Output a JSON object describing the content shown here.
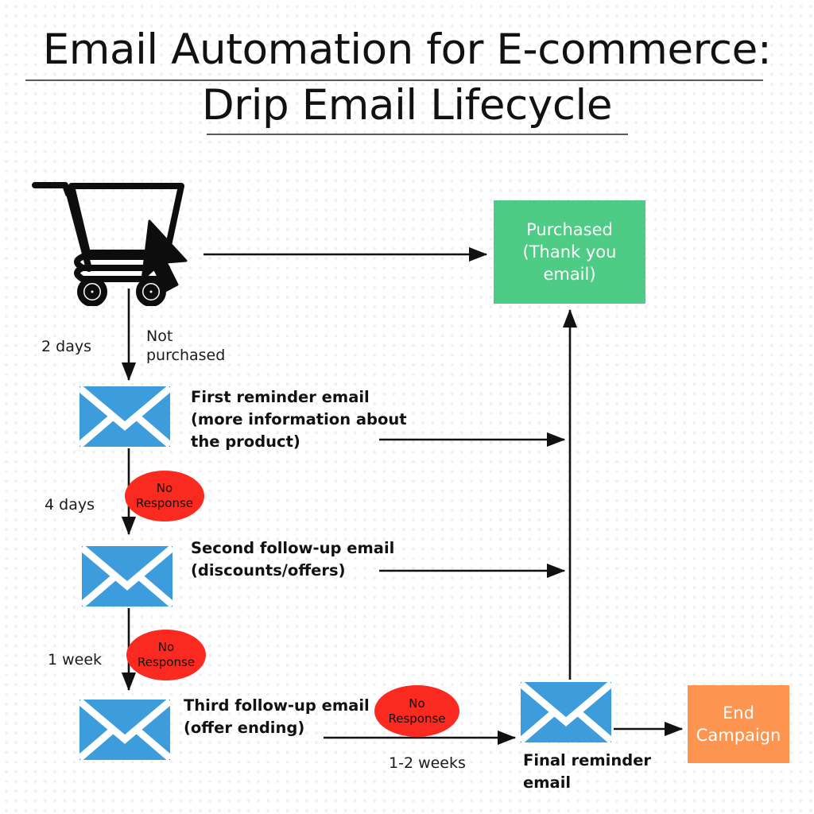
{
  "title": {
    "line1": "Email Automation for E-commerce:",
    "line2": "Drip Email Lifecycle"
  },
  "nodes": {
    "cart": {
      "icon": "shopping-cart-cursor-icon"
    },
    "purchased": {
      "label": "Purchased\n(Thank you\nemail)",
      "color": "#4ECB85",
      "text_color": "#FFFFFF"
    },
    "first_email": {
      "icon": "envelope-icon",
      "label": "First reminder email\n(more information about\nthe product)",
      "color": "#3C9CDC"
    },
    "second_email": {
      "icon": "envelope-icon",
      "label": "Second follow-up email\n(discounts/offers)",
      "color": "#3C9CDC"
    },
    "third_email": {
      "icon": "envelope-icon",
      "label": "Third follow-up email\n(offer ending)",
      "color": "#3C9CDC"
    },
    "final_email": {
      "icon": "envelope-icon",
      "label": "Final reminder\nemail",
      "color": "#3C9CDC"
    },
    "end_campaign": {
      "label": "End\nCampaign",
      "color": "#FD9551",
      "text_color": "#FFFFFF"
    }
  },
  "decisions": {
    "no_response_1": {
      "label": "No\nResponse",
      "color": "#FA2A20"
    },
    "no_response_2": {
      "label": "No\nResponse",
      "color": "#FA2A20"
    },
    "no_response_3": {
      "label": "No\nResponse",
      "color": "#FA2A20"
    }
  },
  "edge_labels": {
    "two_days": "2 days",
    "not_purchased": "Not\npurchased",
    "four_days": "4 days",
    "one_week": "1 week",
    "one_to_two_weeks": "1-2 weeks"
  }
}
